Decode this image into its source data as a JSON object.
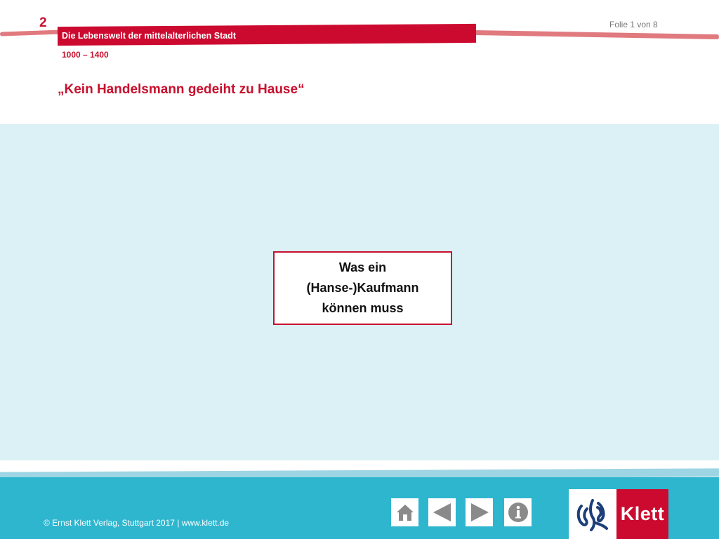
{
  "header": {
    "chapter_number": "2",
    "slide_counter": "Folie 1 von 8",
    "band_title": "Die Lebenswelt der mittelalterlichen Stadt",
    "period": "1000 – 1400",
    "slide_title": "„Kein Handelsmann gedeiht zu Hause“"
  },
  "main": {
    "topic_box": {
      "lines": [
        "Was ein",
        "(Hanse-)Kaufmann",
        "können muss"
      ]
    }
  },
  "footer": {
    "copyright": "© Ernst Klett Verlag, Stuttgart 2017 | www.klett.de",
    "nav": [
      {
        "name": "home",
        "icon": "home-icon"
      },
      {
        "name": "previous",
        "icon": "arrow-left-icon"
      },
      {
        "name": "next",
        "icon": "arrow-right-icon"
      },
      {
        "name": "info",
        "icon": "info-icon"
      }
    ],
    "logo": {
      "text": "Klett",
      "mark_icon": "klett-emblem-icon"
    }
  },
  "colors": {
    "accent_red": "#c8102e",
    "band_red": "#cc0a2f",
    "content_bg": "#dbf1f6",
    "footer_bg": "#2eb6cf",
    "nav_icon_gray": "#8a8a8a"
  }
}
